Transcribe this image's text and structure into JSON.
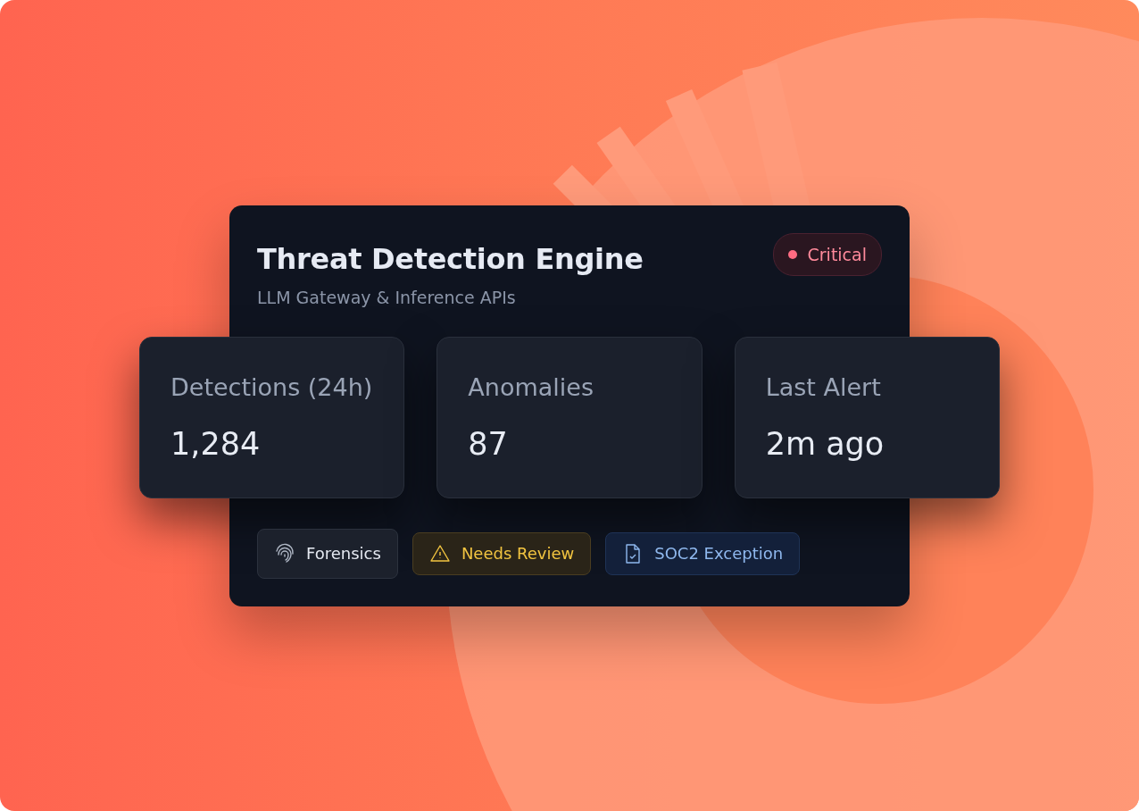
{
  "card": {
    "title": "Threat Detection Engine",
    "subtitle": "LLM Gateway & Inference APIs",
    "status": {
      "label": "Critical",
      "kind": "critical"
    },
    "stats": [
      {
        "label": "Detections (24h)",
        "value": "1,284"
      },
      {
        "label": "Anomalies",
        "value": "87"
      },
      {
        "label": "Last Alert",
        "value": "2m ago"
      }
    ],
    "tags": [
      {
        "label": "Forensics",
        "kind": "fingerprint"
      },
      {
        "label": "Needs Review",
        "kind": "warning"
      },
      {
        "label": "SOC2 Exception",
        "kind": "document"
      }
    ]
  }
}
